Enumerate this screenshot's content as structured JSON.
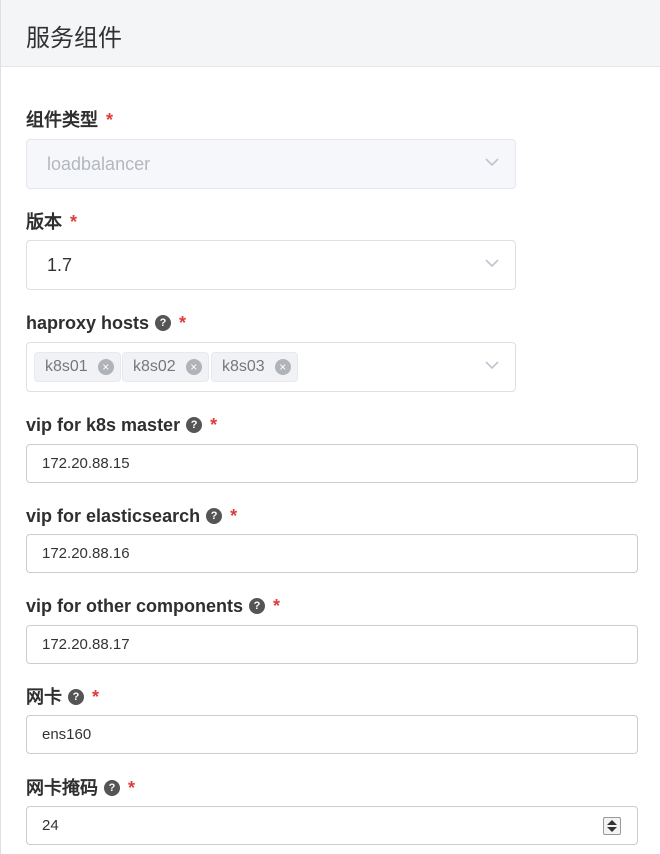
{
  "header": {
    "title": "服务组件"
  },
  "fields": {
    "component_type": {
      "label": "组件类型",
      "value": "loadbalancer",
      "required": "*"
    },
    "version": {
      "label": "版本",
      "value": "1.7",
      "required": "*"
    },
    "haproxy_hosts": {
      "label": "haproxy hosts",
      "required": "*",
      "tags": [
        "k8s01",
        "k8s02",
        "k8s03"
      ]
    },
    "vip_k8s_master": {
      "label": "vip for k8s master",
      "value": "172.20.88.15",
      "required": "*"
    },
    "vip_elasticsearch": {
      "label": "vip for elasticsearch",
      "value": "172.20.88.16",
      "required": "*"
    },
    "vip_other": {
      "label": "vip for other components",
      "value": "172.20.88.17",
      "required": "*"
    },
    "nic": {
      "label": "网卡",
      "value": "ens160",
      "required": "*"
    },
    "nic_mask": {
      "label": "网卡掩码",
      "value": "24",
      "required": "*"
    }
  },
  "icons": {
    "help": "?",
    "tag_close": "×"
  },
  "colors": {
    "required": "#e03a3a",
    "header_bg": "#f4f5f7"
  }
}
